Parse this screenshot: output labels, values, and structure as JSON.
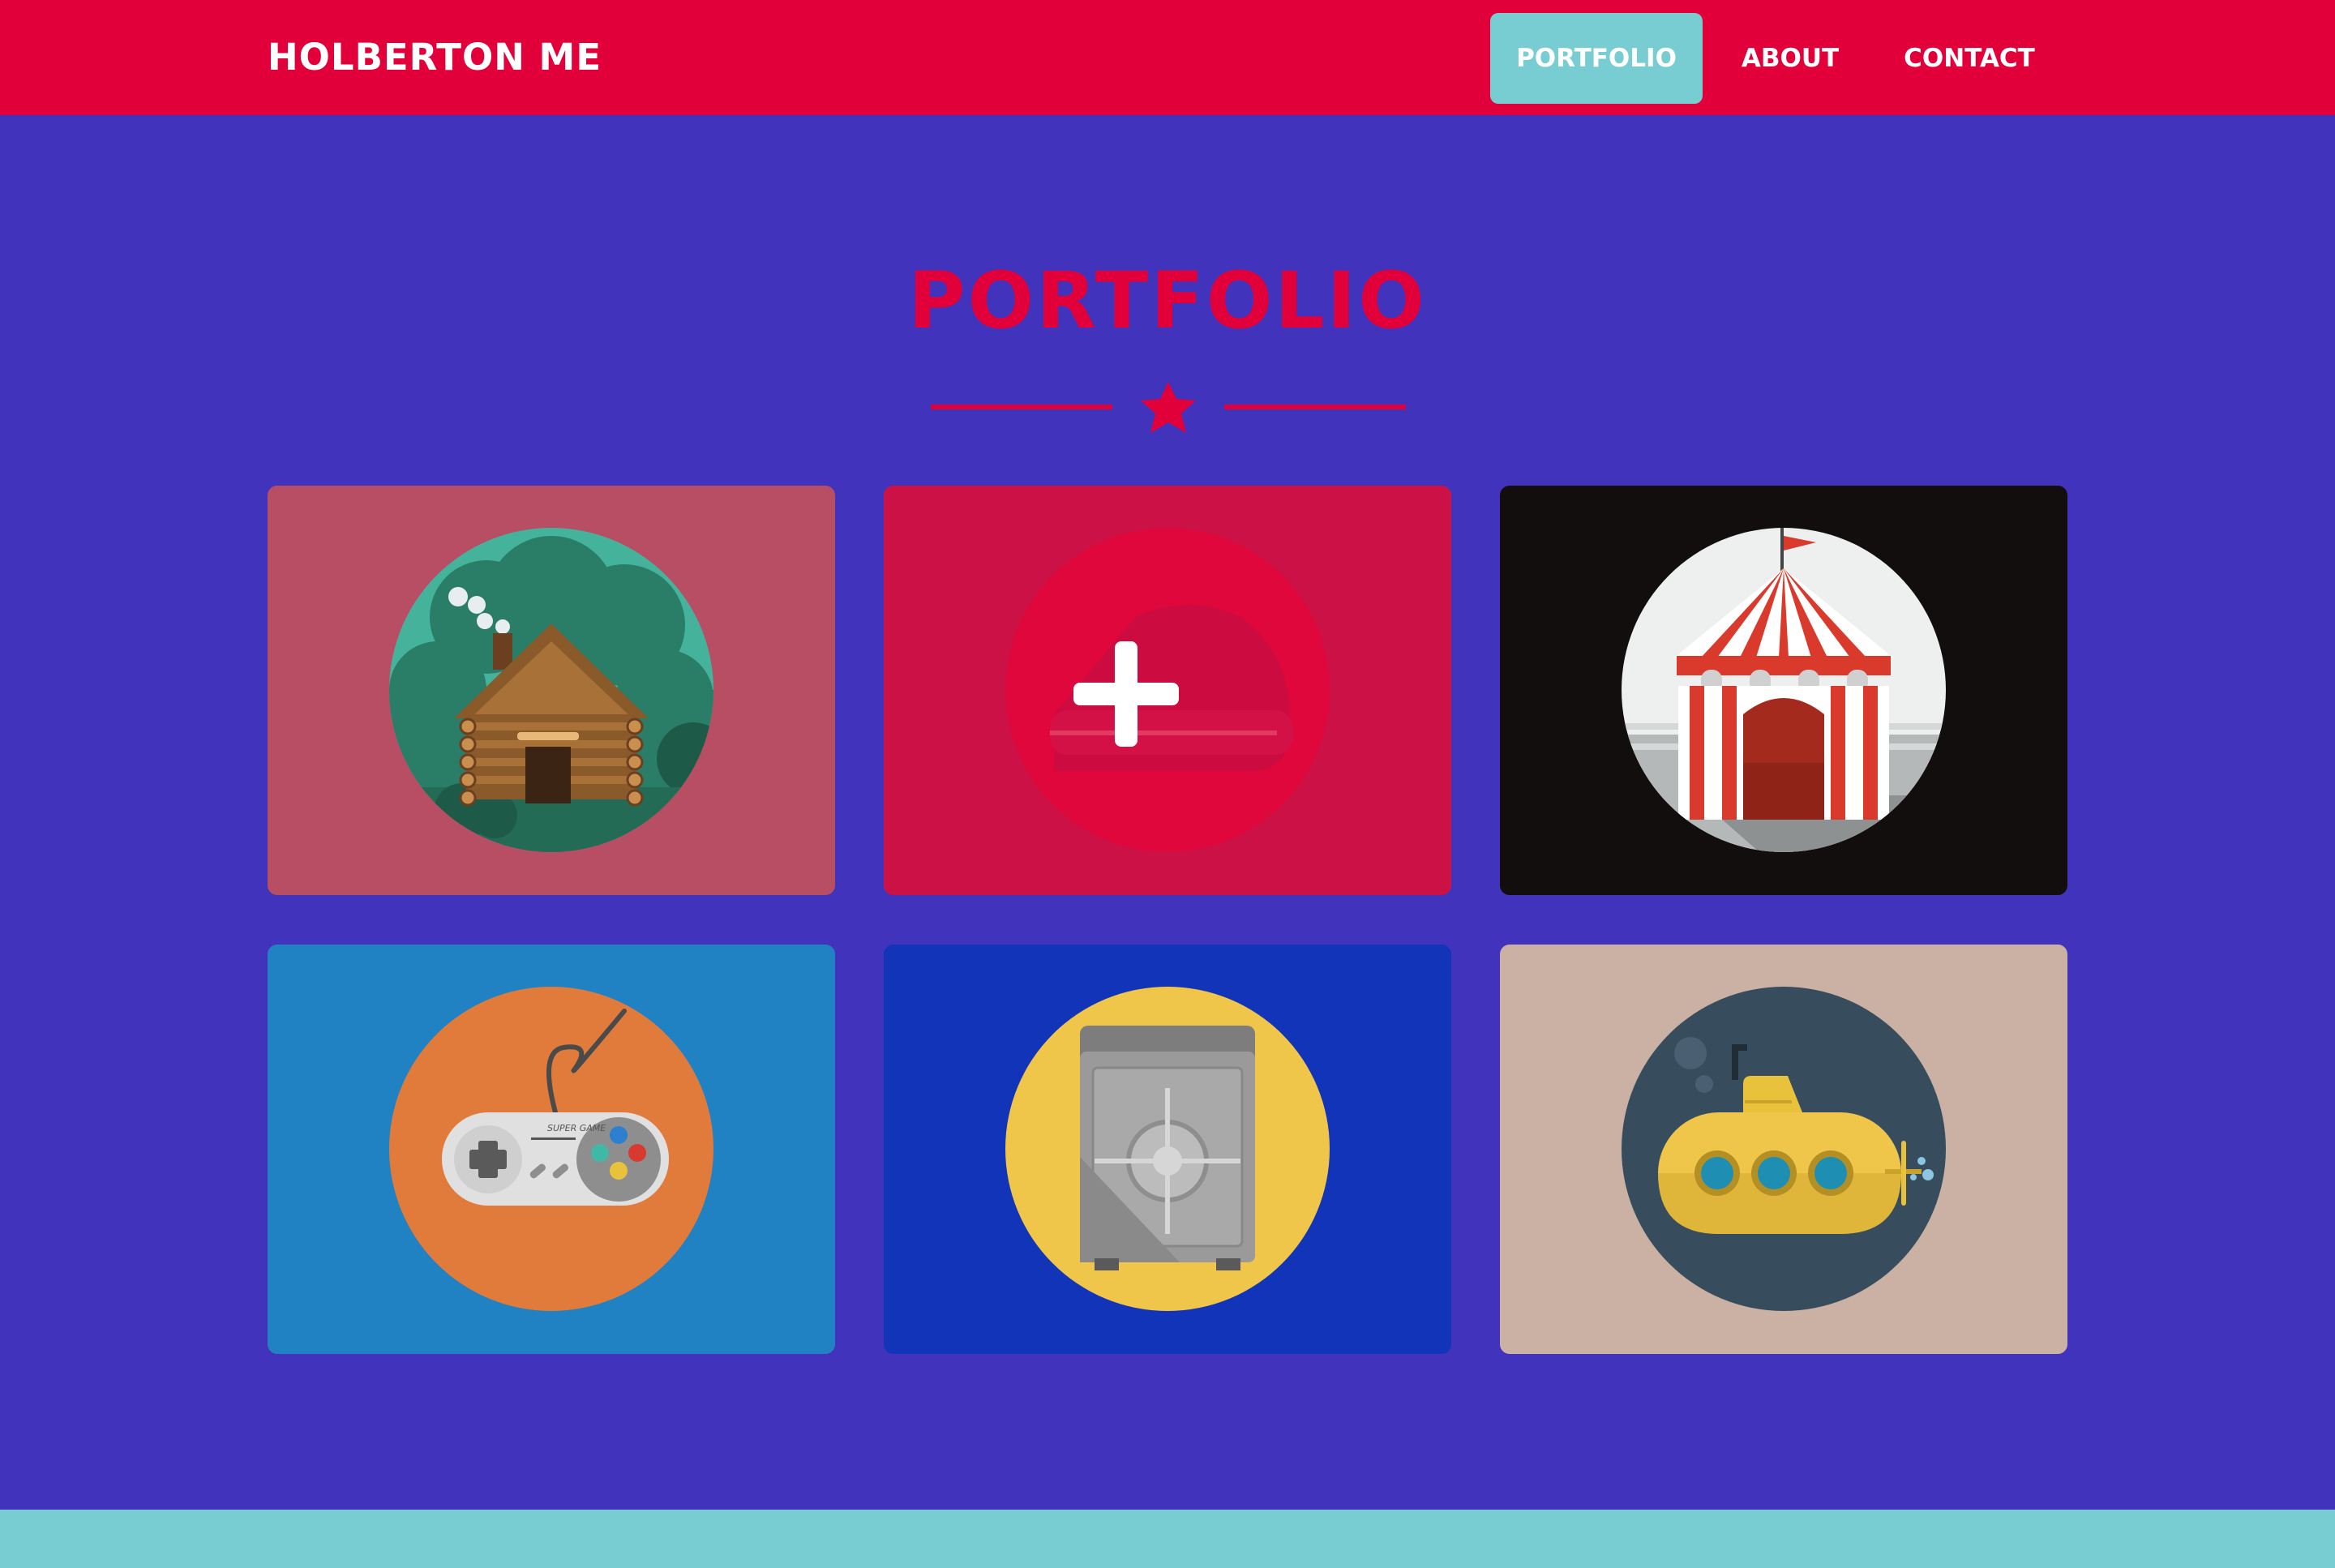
{
  "navbar": {
    "brand": "HOLBERTON ME",
    "items": [
      {
        "label": "PORTFOLIO",
        "active": true
      },
      {
        "label": "ABOUT",
        "active": false
      },
      {
        "label": "CONTACT",
        "active": false
      }
    ]
  },
  "portfolio": {
    "title": "PORTFOLIO",
    "divider_icon": "star-icon",
    "items": [
      {
        "name": "cabin",
        "icon": "log-cabin-icon",
        "bg": "#b74e63",
        "circle": "#45b39c"
      },
      {
        "name": "cake",
        "icon": "plus-icon",
        "bg": "#cc1147",
        "circle": "#e0073c"
      },
      {
        "name": "circus",
        "icon": "circus-tent-icon",
        "bg": "#120e0e",
        "circle": "#eef0f0"
      },
      {
        "name": "game",
        "icon": "game-controller-icon",
        "bg": "#2182c3",
        "circle": "#e07b3c"
      },
      {
        "name": "safe",
        "icon": "safe-icon",
        "bg": "#1134b8",
        "circle": "#f0c64a"
      },
      {
        "name": "submarine",
        "icon": "submarine-icon",
        "bg": "#cbb1a3",
        "circle": "#374d5e"
      }
    ],
    "game_controller_text": "SUPER GAME"
  },
  "colors": {
    "navbar": "#e1003a",
    "page": "#4233bd",
    "accent": "#77cdd1",
    "title": "#e1003a"
  }
}
